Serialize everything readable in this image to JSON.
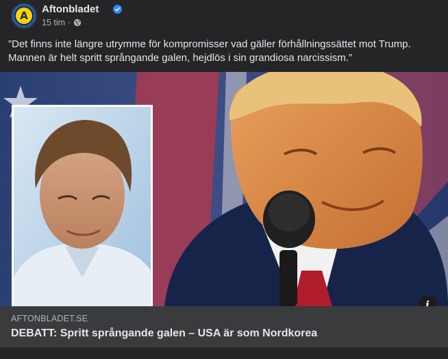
{
  "post": {
    "page_name": "Aftonbladet",
    "time": "15 tim",
    "separator": "·",
    "caption": "”Det finns inte längre utrymme för kompromisser vad gäller förhållningssättet mot Trump. Mannen är helt spritt språngande galen, hejdlös i sin grandiosa narcissism.”",
    "avatar_letter": "A",
    "icons": {
      "verified": "verified-badge-icon",
      "audience": "globe-icon",
      "info": "info-icon"
    },
    "colors": {
      "background": "#242526",
      "card": "#3a3b3c",
      "verified": "#2d88ff",
      "brand_yellow": "#ffd200",
      "brand_blue": "#0e2a55"
    }
  },
  "link": {
    "domain": "AFTONBLADET.SE",
    "title": "DEBATT: Spritt språngande galen – USA är som Nordkorea",
    "info_glyph": "i"
  }
}
